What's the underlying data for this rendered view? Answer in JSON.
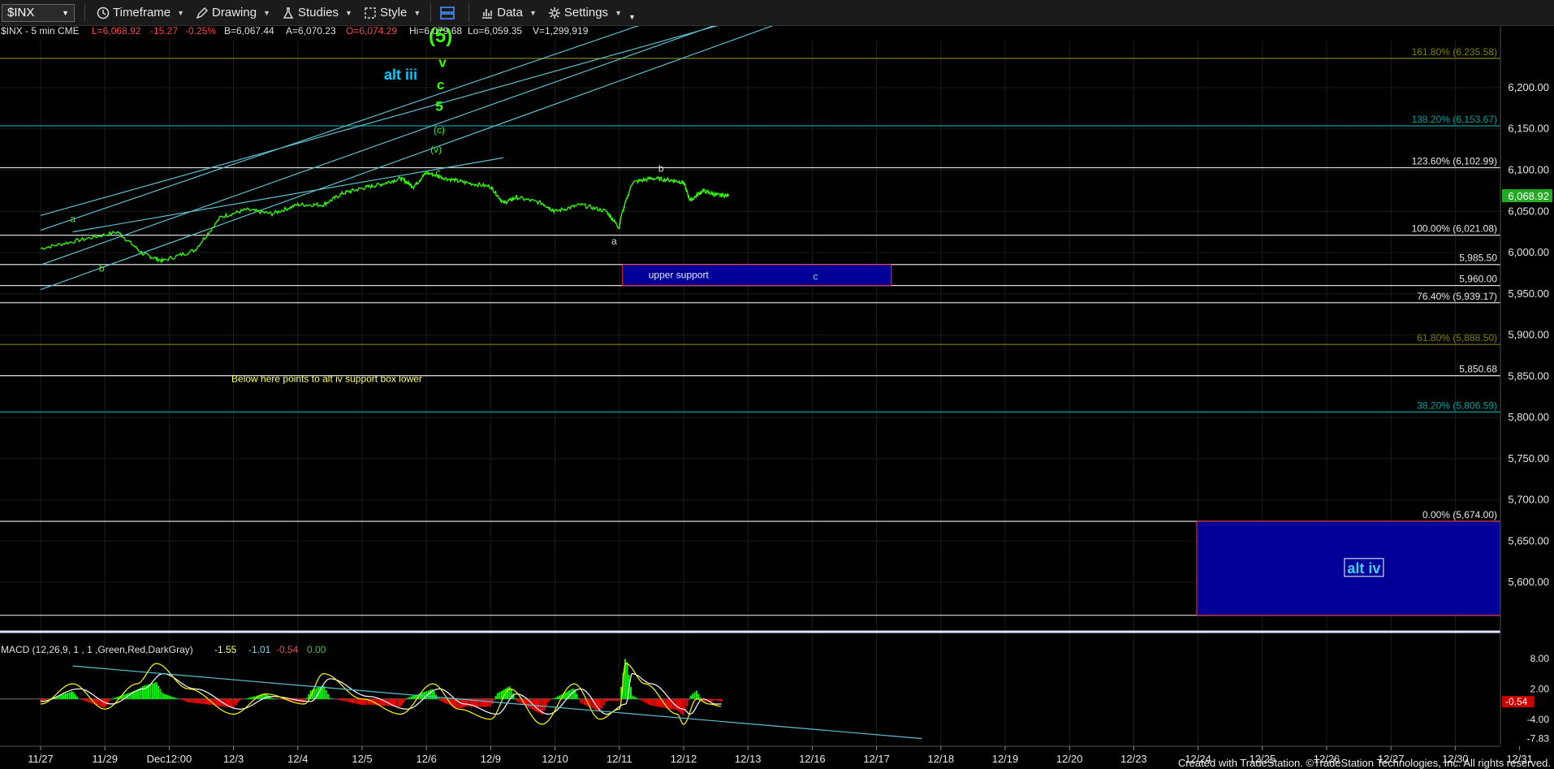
{
  "toolbar": {
    "symbol": "$INX",
    "timeframe": "Timeframe",
    "drawing": "Drawing",
    "studies": "Studies",
    "style": "Style",
    "data": "Data",
    "settings": "Settings"
  },
  "header": {
    "symbol_info": "$INX - 5 min  CME",
    "last": "L=6,068.92",
    "change": "-15.27",
    "change_pct": "-0.25%",
    "bid": "B=6,067.44",
    "ask": "A=6,070.23",
    "open": "O=6,074.29",
    "high": "Hi=6,079.68",
    "low": "Lo=6,059.35",
    "volume": "V=1,299,919"
  },
  "colors": {
    "price": "#33ff00",
    "fib_cyan": "#00a0a0",
    "fib_olive": "#808000",
    "hline_white": "#d8d8d8",
    "box_fill": "#000099",
    "box_border": "#ff3333",
    "wave_green": "#33ff00",
    "wave_cyan": "#00ccff",
    "note_yellow": "#ffff66",
    "macd_line": "#ffff00",
    "signal_line": "#ffffff",
    "hist_pos": "#00ff00",
    "hist_neg": "#ff0000"
  },
  "chart_data": [
    {
      "type": "line",
      "name": "price",
      "ylim": [
        5540,
        6265
      ],
      "y_ticks": [
        "6,200.00",
        "6,150.00",
        "6,100.00",
        "6,050.00",
        "6,000.00",
        "5,950.00",
        "5,900.00",
        "5,850.00",
        "5,800.00",
        "5,750.00",
        "5,700.00",
        "5,650.00",
        "5,600.00"
      ],
      "last_value": "6,068.92",
      "x_ticks": [
        "11/27",
        "11/29",
        "Dec12:00",
        "12/3",
        "12/4",
        "12/5",
        "12/6",
        "12/9",
        "12/10",
        "12/11",
        "12/12",
        "12/13",
        "12/16",
        "12/17",
        "12/18",
        "12/19",
        "12/20",
        "12/23",
        "12/24",
        "12/25",
        "12/26",
        "12/27",
        "12/30",
        "12/31"
      ],
      "series": [
        {
          "x": [
            0,
            0.6,
            1.2,
            1.6,
            1.9,
            2.4,
            2.8,
            3.2,
            3.6,
            4.0,
            4.4,
            4.7,
            5.0,
            5.3,
            5.6,
            5.8,
            6.0,
            6.3,
            6.6,
            7.0,
            7.2,
            7.4,
            7.8,
            8.0,
            8.4,
            8.8,
            9.0,
            9.02,
            9.2,
            9.5,
            9.8,
            10.0,
            10.1,
            10.3,
            10.5,
            10.7
          ],
          "values": [
            6005,
            6015,
            6025,
            5998,
            5990,
            6003,
            6043,
            6052,
            6047,
            6058,
            6058,
            6072,
            6078,
            6083,
            6090,
            6080,
            6097,
            6090,
            6085,
            6080,
            6060,
            6067,
            6060,
            6050,
            6058,
            6050,
            6030,
            6042,
            6085,
            6090,
            6088,
            6085,
            6063,
            6075,
            6070,
            6069
          ]
        }
      ],
      "hlines": [
        {
          "value": 6235.58,
          "label": "161.80% (6,235.58)",
          "color": "olive"
        },
        {
          "value": 6153.67,
          "label": "138.20% (6,153.67)",
          "color": "cyan"
        },
        {
          "value": 6102.99,
          "label": "123.60% (6,102.99)",
          "color": "white"
        },
        {
          "value": 6021.08,
          "label": "100.00% (6,021.08)",
          "color": "white"
        },
        {
          "value": 5985.5,
          "label": "5,985.50",
          "color": "white"
        },
        {
          "value": 5960.0,
          "label": "5,960.00",
          "color": "white"
        },
        {
          "value": 5939.17,
          "label": "76.40% (5,939.17)",
          "color": "white"
        },
        {
          "value": 5888.5,
          "label": "61.80% (5,888.50)",
          "color": "olive"
        },
        {
          "value": 5850.68,
          "label": "5,850.68",
          "color": "white"
        },
        {
          "value": 5806.59,
          "label": "38.20% (5,806.59)",
          "color": "cyan"
        },
        {
          "value": 5674.0,
          "label": "0.00% (5,674.00)",
          "color": "white"
        },
        {
          "value": 5560.0,
          "label": "5,560.00",
          "color": "white"
        }
      ],
      "trendlines": [
        {
          "x0": 0,
          "y0": 6045,
          "x1": 12.8,
          "y1": 6325
        },
        {
          "x0": 0,
          "y0": 6027,
          "x1": 10.6,
          "y1": 6310
        },
        {
          "x0": 0.5,
          "y0": 6025,
          "x1": 7.2,
          "y1": 6115
        },
        {
          "x0": 0,
          "y0": 5985,
          "x1": 11.0,
          "y1": 6290
        },
        {
          "x0": 0,
          "y0": 5955,
          "x1": 12.8,
          "y1": 6315
        }
      ],
      "boxes": [
        {
          "x0": 9.05,
          "x1": 13.23,
          "y0": 5960,
          "y1": 5985.5,
          "label": "upper support"
        },
        {
          "x0": 17.98,
          "x1": 23.18,
          "y0": 5560,
          "y1": 5674,
          "label": "alt iv"
        }
      ],
      "annotations": [
        {
          "text": "(5)",
          "x": 6.22,
          "y": 6255,
          "style": "green-xl"
        },
        {
          "text": "alt iii",
          "x": 5.6,
          "y": 6210,
          "style": "cyan-big"
        },
        {
          "text": "v",
          "x": 6.25,
          "y": 6225,
          "style": "green-big"
        },
        {
          "text": "c",
          "x": 6.22,
          "y": 6198,
          "style": "green-big"
        },
        {
          "text": "5",
          "x": 6.2,
          "y": 6172,
          "style": "green-big"
        },
        {
          "text": "(c)",
          "x": 6.2,
          "y": 6145,
          "style": "green"
        },
        {
          "text": "(v)",
          "x": 6.15,
          "y": 6121,
          "style": "green"
        },
        {
          "text": "c",
          "x": 6.18,
          "y": 6093,
          "style": "green"
        },
        {
          "text": "a",
          "x": 0.5,
          "y": 6037,
          "style": "green"
        },
        {
          "text": "b",
          "x": 0.95,
          "y": 5977,
          "style": "green"
        },
        {
          "text": "a",
          "x": 8.92,
          "y": 6010,
          "style": "white"
        },
        {
          "text": "b",
          "x": 9.65,
          "y": 6098,
          "style": "white"
        },
        {
          "text": "c",
          "x": 12.05,
          "y": 5967,
          "style": "cyan-small"
        },
        {
          "text": "Below here points to alt iv support box lower",
          "x": 4.45,
          "y": 5843,
          "style": "yellow"
        }
      ]
    },
    {
      "type": "line",
      "name": "MACD",
      "title": "MACD (12,26,9, 1 , 1 ,Green,Red,DarkGray)",
      "readouts": [
        "-1.55",
        "-1.01",
        "-0.54",
        "0.00"
      ],
      "ylim": [
        -9,
        11
      ],
      "y_ticks": [
        "8.00",
        "2.00",
        "-4.00",
        "-7.83"
      ],
      "last_value": "-0.54",
      "series": [
        {
          "name": "",
          "x": [
            0,
            0.5,
            1.0,
            1.5,
            1.8,
            2.3,
            3.0,
            3.5,
            4.1,
            4.4,
            5.0,
            5.6,
            6.1,
            6.5,
            7.0,
            7.3,
            7.8,
            8.3,
            8.7,
            9.0,
            9.1,
            9.4,
            9.9,
            10.0,
            10.2,
            10.4,
            10.6
          ],
          "values": [
            -1,
            3,
            -2,
            3,
            7,
            2,
            -3,
            1,
            -1,
            5,
            0,
            -3,
            3,
            -2,
            -4,
            2,
            -5,
            3,
            -4,
            -2,
            7,
            3,
            -3,
            -5,
            0,
            -1,
            -1.5
          ]
        },
        {
          "name": "",
          "x": [
            0,
            0.6,
            1.1,
            1.6,
            1.9,
            2.4,
            3.1,
            3.6,
            4.2,
            4.5,
            5.1,
            5.7,
            6.2,
            6.6,
            7.1,
            7.4,
            7.9,
            8.4,
            8.8,
            9.1,
            9.2,
            9.5,
            10.0,
            10.1,
            10.3,
            10.5,
            10.6
          ],
          "values": [
            -0.5,
            2,
            -1,
            2,
            5,
            2,
            -2,
            0.5,
            -0.5,
            4,
            0.5,
            -2,
            2,
            -1,
            -3,
            1,
            -3,
            2,
            -3,
            -1,
            5,
            3,
            -2,
            -3,
            0,
            -1,
            -1
          ]
        }
      ],
      "trendline": {
        "x0": 0.5,
        "y0": 6.5,
        "x1": 13.7,
        "y1": -7.8
      }
    }
  ],
  "footer": {
    "credit": "Created with TradeStation. ©TradeStation Technologies, Inc. All rights reserved."
  }
}
